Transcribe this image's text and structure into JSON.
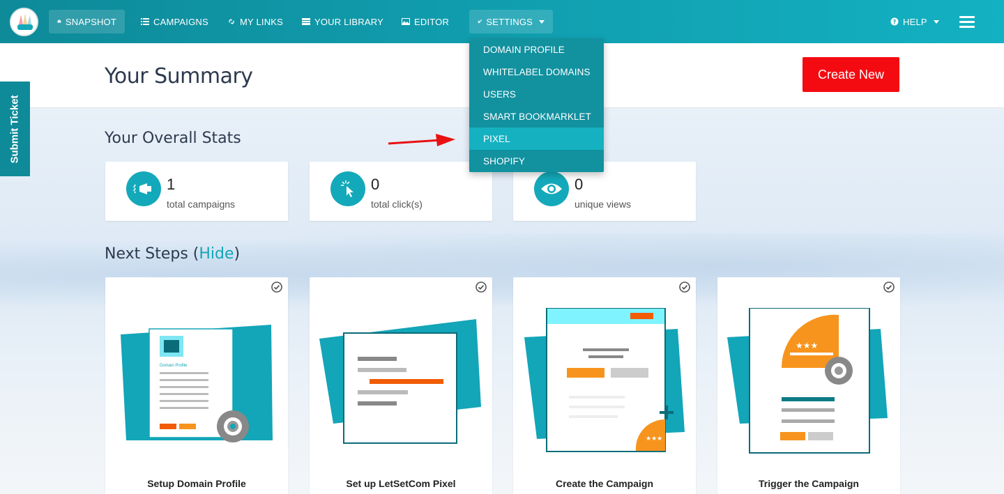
{
  "nav": {
    "snapshot": "SNAPSHOT",
    "campaigns": "CAMPAIGNS",
    "my_links": "MY LINKS",
    "your_library": "YOUR LIBRARY",
    "editor": "EDITOR",
    "settings": "SETTINGS",
    "help": "HELP"
  },
  "settings_menu": [
    "DOMAIN PROFILE",
    "WHITELABEL DOMAINS",
    "USERS",
    "SMART BOOKMARKLET",
    "PIXEL",
    "SHOPIFY"
  ],
  "header": {
    "title": "Your Summary",
    "create_button": "Create New"
  },
  "submit_ticket": "Submit Ticket",
  "overall_stats": {
    "title": "Your Overall Stats",
    "cards": [
      {
        "value": "1",
        "label": "total campaigns",
        "icon": "megaphone-icon"
      },
      {
        "value": "0",
        "label": "total click(s)",
        "icon": "cursor-click-icon"
      },
      {
        "value": "0",
        "label": "unique views",
        "icon": "eye-icon"
      }
    ]
  },
  "next_steps": {
    "title": "Next Steps (",
    "hide": "Hide",
    "close_paren": ")",
    "cards": [
      {
        "title": "Setup Domain Profile",
        "illustration_text": "Domain Profile"
      },
      {
        "title": "Set up LetSetCom Pixel"
      },
      {
        "title": "Create the Campaign"
      },
      {
        "title": "Trigger the Campaign"
      }
    ]
  },
  "colors": {
    "primary": "#12919f",
    "accent_red": "#f40b12",
    "orange": "#f7941d"
  }
}
